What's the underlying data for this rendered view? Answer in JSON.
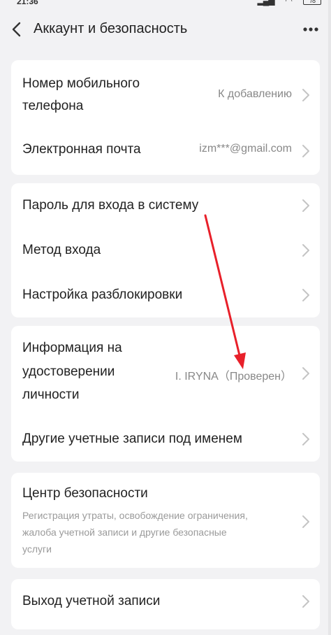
{
  "status_bar": {
    "time": "21:36",
    "battery": "78"
  },
  "header": {
    "title": "Аккаунт и безопасность",
    "back_icon": "chevron-left-icon",
    "more_icon": "more-dots-icon"
  },
  "groups": {
    "contact": {
      "phone_label_1": "Номер мобильного",
      "phone_label_2": "телефона",
      "phone_value": "К добавлению",
      "email_label": "Электронная почта",
      "email_value": "izm***@gmail.com"
    },
    "login": {
      "password_label": "Пароль для входа в систему",
      "method_label": "Метод входа",
      "unlock_label": "Настройка разблокировки"
    },
    "identity": {
      "id_label_1": "Информация на",
      "id_label_2": "удостоверении",
      "id_label_3": "личности",
      "id_value": "I. IRYNA（Проверен）",
      "other_accounts_label": "Другие учетные записи под именем"
    },
    "security": {
      "center_label": "Центр безопасности",
      "center_desc_1": "Регистрация утраты, освобождение ограничения,",
      "center_desc_2": "жалоба учетной записи и другие безопасные",
      "center_desc_3": "услуги"
    },
    "logout": {
      "label": "Выход учетной записи"
    }
  },
  "colors": {
    "background": "#f2f2f4",
    "card": "#ffffff",
    "secondary_text": "#888888",
    "chevron": "#c4c4c4",
    "annotation_arrow": "#e8202a"
  }
}
